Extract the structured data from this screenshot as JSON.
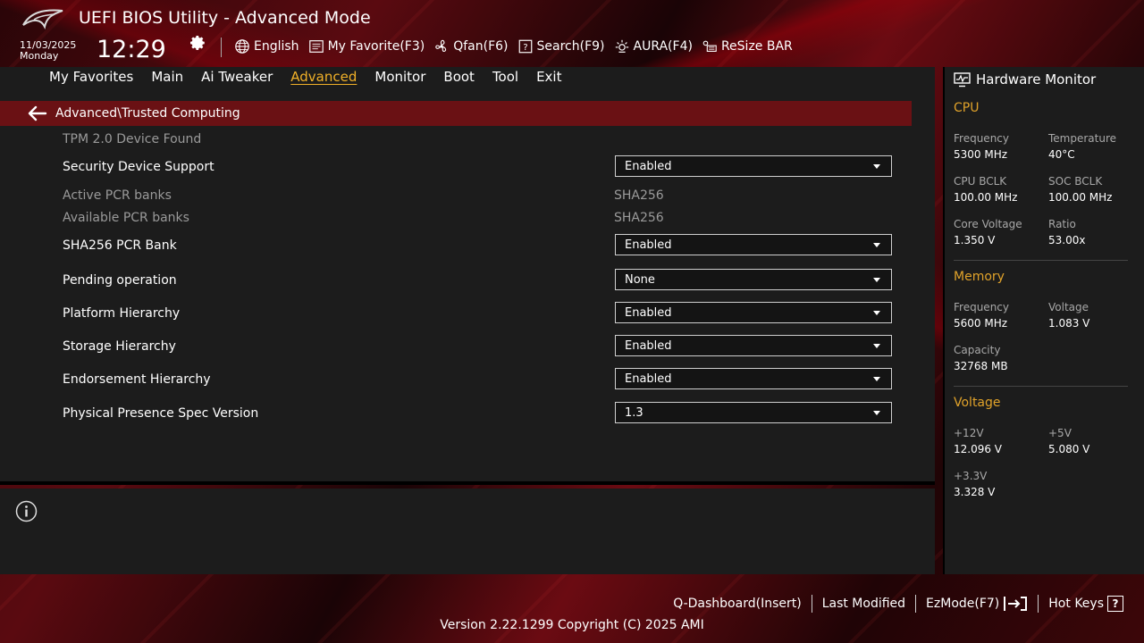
{
  "app": {
    "title": "UEFI BIOS Utility - Advanced Mode",
    "date": "11/03/2025",
    "weekday": "Monday",
    "time": "12:29"
  },
  "toolbar": {
    "language": "English",
    "favorite": "My Favorite(F3)",
    "qfan": "Qfan(F6)",
    "search": "Search(F9)",
    "aura": "AURA(F4)",
    "resize_bar": "ReSize BAR"
  },
  "nav": {
    "items": [
      "My Favorites",
      "Main",
      "Ai Tweaker",
      "Advanced",
      "Monitor",
      "Boot",
      "Tool",
      "Exit"
    ],
    "active": "Advanced"
  },
  "breadcrumb": "Advanced\\Trusted Computing",
  "settings": {
    "tpm_found": "TPM 2.0 Device Found",
    "security_device_support": {
      "label": "Security Device Support",
      "value": "Enabled"
    },
    "active_pcr_banks": {
      "label": "Active PCR banks",
      "value": "SHA256"
    },
    "available_pcr_banks": {
      "label": "Available PCR banks",
      "value": "SHA256"
    },
    "sha256_pcr_bank": {
      "label": "SHA256 PCR Bank",
      "value": "Enabled"
    },
    "pending_operation": {
      "label": "Pending operation",
      "value": "None"
    },
    "platform_hierarchy": {
      "label": "Platform Hierarchy",
      "value": "Enabled"
    },
    "storage_hierarchy": {
      "label": "Storage Hierarchy",
      "value": "Enabled"
    },
    "endorsement_hierarchy": {
      "label": "Endorsement Hierarchy",
      "value": "Enabled"
    },
    "physical_presence": {
      "label": "Physical Presence Spec Version",
      "value": "1.3"
    }
  },
  "hw_monitor": {
    "title": "Hardware Monitor",
    "cpu": {
      "title": "CPU",
      "frequency": {
        "label": "Frequency",
        "value": "5300 MHz"
      },
      "temperature": {
        "label": "Temperature",
        "value": "40°C"
      },
      "cpu_bclk": {
        "label": "CPU BCLK",
        "value": "100.00 MHz"
      },
      "soc_bclk": {
        "label": "SOC BCLK",
        "value": "100.00 MHz"
      },
      "core_voltage": {
        "label": "Core Voltage",
        "value": "1.350 V"
      },
      "ratio": {
        "label": "Ratio",
        "value": "53.00x"
      }
    },
    "memory": {
      "title": "Memory",
      "frequency": {
        "label": "Frequency",
        "value": "5600 MHz"
      },
      "voltage": {
        "label": "Voltage",
        "value": "1.083 V"
      },
      "capacity": {
        "label": "Capacity",
        "value": "32768 MB"
      }
    },
    "voltage": {
      "title": "Voltage",
      "v12": {
        "label": "+12V",
        "value": "12.096 V"
      },
      "v5": {
        "label": "+5V",
        "value": "5.080 V"
      },
      "v33": {
        "label": "+3.3V",
        "value": "3.328 V"
      }
    }
  },
  "footer": {
    "q_dashboard": "Q-Dashboard(Insert)",
    "last_modified": "Last Modified",
    "ezmode": "EzMode(F7)",
    "hot_keys": "Hot Keys",
    "hot_keys_glyph": "?",
    "version": "Version 2.22.1299 Copyright (C) 2025 AMI"
  },
  "colors": {
    "accent": "#f0b028",
    "section_title": "#e0a22a",
    "breadcrumb_bar": "#6a1114"
  }
}
